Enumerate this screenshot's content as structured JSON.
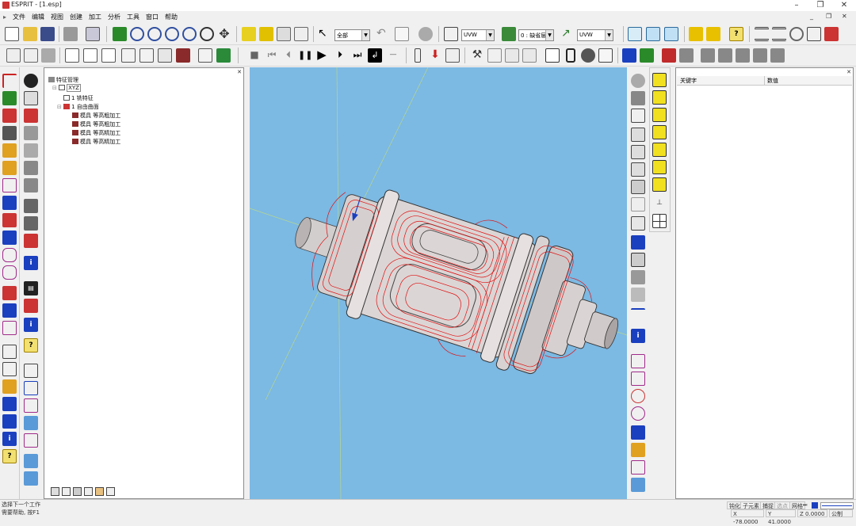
{
  "window": {
    "title": "ESPRIT - [1.esp]",
    "controls": {
      "minimize": "–",
      "maximize": "❐",
      "close": "✕"
    },
    "mdi_controls": {
      "minimize": "_",
      "restore": "❐",
      "close": "✕"
    }
  },
  "menu": [
    "文件",
    "编辑",
    "视图",
    "创建",
    "加工",
    "分析",
    "工具",
    "窗口",
    "帮助"
  ],
  "toolbar": {
    "select_filter": "全部",
    "uvw_1": "UVW",
    "layer_combo": "0 : 缺省层",
    "uvw_2": "UVW"
  },
  "feature_tree": {
    "title": "特征管理",
    "items": [
      {
        "label": "XYZ",
        "level": 1
      },
      {
        "label": "1 铣特征",
        "level": 2
      },
      {
        "label": "1 自由曲面",
        "level": 2
      },
      {
        "label": "模具 等高粗加工",
        "level": 3
      },
      {
        "label": "模具 等高粗加工",
        "level": 3
      },
      {
        "label": "模具 等高精加工",
        "level": 3
      },
      {
        "label": "模具 等高精加工",
        "level": 3
      }
    ]
  },
  "properties": {
    "col_key": "关键字",
    "col_value": "数值"
  },
  "status": {
    "line1": "选择下一个工作",
    "line2": "需要帮助, 按F1",
    "cells": [
      "钝化",
      "子元素",
      "捕捉",
      "选点",
      "网格"
    ],
    "x": "X -78.0000",
    "y": "Y 41.0000",
    "z": "Z 0.0000",
    "units": "公制"
  },
  "colors": {
    "viewport_bg": "#7cb9e3",
    "toolpath": "#e01010",
    "part_body": "#d8d2d2",
    "accent": "#1a3fbf"
  }
}
